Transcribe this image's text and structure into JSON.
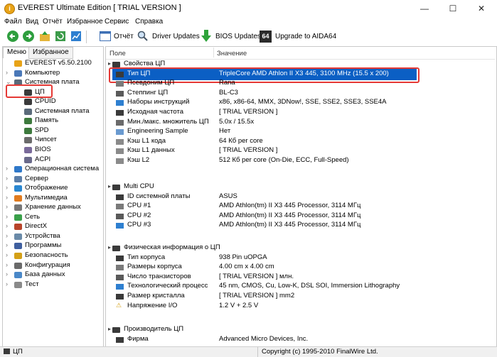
{
  "window": {
    "title": "EVEREST Ultimate Edition  [ TRIAL VERSION ]",
    "app_icon_glyph": "i",
    "minimize": "—",
    "maximize": "☐",
    "close": "✕"
  },
  "menu": [
    "Файл",
    "Вид",
    "Отчёт",
    "Избранное",
    "Сервис",
    "Справка"
  ],
  "toolbar": {
    "report": "Отчёт",
    "driver_updates": "Driver Updates",
    "bios_updates": "BIOS Updates",
    "upgrade": "Upgrade to AIDA64",
    "upgrade_badge": "64"
  },
  "left_tabs": [
    "Меню",
    "Избранное"
  ],
  "tree": [
    {
      "label": "EVEREST v5.50.2100",
      "icon": "everest-icon"
    },
    {
      "label": "Компьютер",
      "icon": "computer-icon"
    },
    {
      "label": "Системная плата",
      "icon": "motherboard-icon"
    },
    {
      "label": "ЦП",
      "icon": "cpu-icon"
    },
    {
      "label": "CPUID",
      "icon": "cpuid-icon"
    },
    {
      "label": "Системная плата",
      "icon": "motherboard-icon"
    },
    {
      "label": "Память",
      "icon": "memory-icon"
    },
    {
      "label": "SPD",
      "icon": "spd-icon"
    },
    {
      "label": "Чипсет",
      "icon": "chipset-icon"
    },
    {
      "label": "BIOS",
      "icon": "bios-icon"
    },
    {
      "label": "ACPI",
      "icon": "acpi-icon"
    },
    {
      "label": "Операционная система",
      "icon": "os-icon"
    },
    {
      "label": "Сервер",
      "icon": "server-icon"
    },
    {
      "label": "Отображение",
      "icon": "display-icon"
    },
    {
      "label": "Мультимедиа",
      "icon": "multimedia-icon"
    },
    {
      "label": "Хранение данных",
      "icon": "storage-icon"
    },
    {
      "label": "Сеть",
      "icon": "network-icon"
    },
    {
      "label": "DirectX",
      "icon": "directx-icon"
    },
    {
      "label": "Устройства",
      "icon": "devices-icon"
    },
    {
      "label": "Программы",
      "icon": "programs-icon"
    },
    {
      "label": "Безопасность",
      "icon": "security-icon"
    },
    {
      "label": "Конфигурация",
      "icon": "config-icon"
    },
    {
      "label": "База данных",
      "icon": "database-icon"
    },
    {
      "label": "Тест",
      "icon": "test-icon"
    }
  ],
  "columns": {
    "field": "Поле",
    "value": "Значение"
  },
  "sections": [
    {
      "title": "Свойства ЦП",
      "rows": [
        {
          "field": "Тип ЦП",
          "value": "TripleCore AMD Athlon II X3 445, 3100 MHz (15.5 x 200)"
        },
        {
          "field": "Псевдоним ЦП",
          "value": "Rana"
        },
        {
          "field": "Степпинг ЦП",
          "value": "BL-C3"
        },
        {
          "field": "Наборы инструкций",
          "value": "x86, x86-64, MMX, 3DNow!, SSE, SSE2, SSE3, SSE4A"
        },
        {
          "field": "Исходная частота",
          "value": "[ TRIAL VERSION ]"
        },
        {
          "field": "Мин./макс. множитель ЦП",
          "value": "5.0x / 15.5x"
        },
        {
          "field": "Engineering Sample",
          "value": "Нет"
        },
        {
          "field": "Кэш L1 кода",
          "value": "64 Кб per core"
        },
        {
          "field": "Кэш L1 данных",
          "value": "[ TRIAL VERSION ]"
        },
        {
          "field": "Кэш L2",
          "value": "512 Кб per core  (On-Die, ECC, Full-Speed)"
        }
      ]
    },
    {
      "title": "Multi CPU",
      "rows": [
        {
          "field": "ID системной платы",
          "value": "ASUS"
        },
        {
          "field": "CPU #1",
          "value": "AMD Athlon(tm) II X3 445 Processor, 3114 МГц"
        },
        {
          "field": "CPU #2",
          "value": "AMD Athlon(tm) II X3 445 Processor, 3114 МГц"
        },
        {
          "field": "CPU #3",
          "value": "AMD Athlon(tm) II X3 445 Processor, 3114 МГц"
        }
      ]
    },
    {
      "title": "Физическая информация о ЦП",
      "rows": [
        {
          "field": "Тип корпуса",
          "value": "938 Pin uOPGA"
        },
        {
          "field": "Размеры корпуса",
          "value": "4.00 cm x 4.00 cm"
        },
        {
          "field": "Число транзисторов",
          "value": "[ TRIAL VERSION ] млн."
        },
        {
          "field": "Технологический процесс",
          "value": "45 nm, CMOS, Cu, Low-K, DSL SOI, Immersion Lithography"
        },
        {
          "field": "Размер кристалла",
          "value": "[ TRIAL VERSION ] mm2"
        },
        {
          "field": "Напряжение I/O",
          "value": "1.2 V + 2.5 V"
        }
      ]
    },
    {
      "title": "Производитель ЦП",
      "rows": [
        {
          "field": "Фирма",
          "value": "Advanced Micro Devices, Inc."
        }
      ]
    }
  ],
  "status": {
    "left": "ЦП",
    "right": "Copyright (c) 1995-2010 FinalWire Ltd."
  },
  "colors": {
    "highlight": "#0b5fc4",
    "annotation": "#e53935",
    "title_bg": "#ffffff"
  }
}
